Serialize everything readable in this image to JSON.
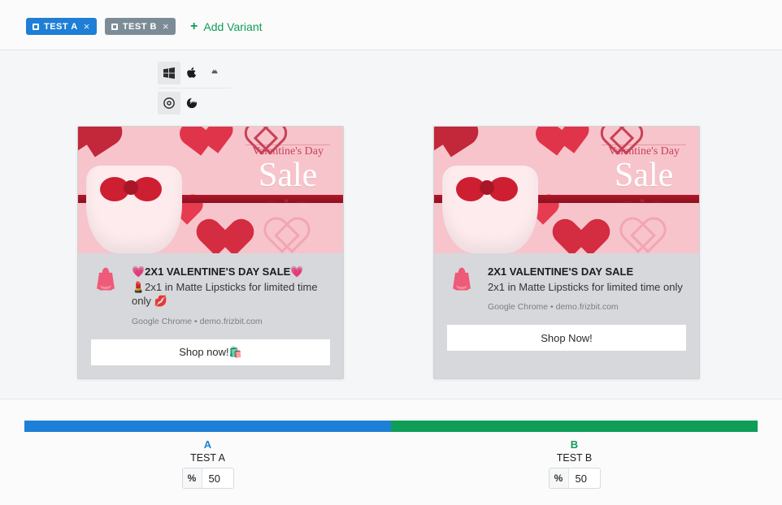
{
  "topbar": {
    "variants": [
      {
        "label": "TEST A",
        "active": true
      },
      {
        "label": "TEST B",
        "active": false
      }
    ],
    "add_variant_label": "Add Variant"
  },
  "toolbar": {
    "os_icons": [
      "windows",
      "apple",
      "android"
    ],
    "browser_icons": [
      "chrome",
      "firefox"
    ]
  },
  "hero": {
    "small_text": "Valentine's Day",
    "sale_text": "Sale"
  },
  "notif_a": {
    "title": "💗2X1 VALENTINE'S DAY SALE💗",
    "subtitle": "💄2x1 in Matte Lipsticks for limited time only 💋",
    "meta": "Google Chrome • demo.frizbit.com",
    "cta": "Shop now!🛍️"
  },
  "notif_b": {
    "title": "2X1 VALENTINE'S DAY SALE",
    "subtitle": "2x1 in Matte Lipsticks for limited time only",
    "meta": "Google Chrome • demo.frizbit.com",
    "cta": "Shop Now!"
  },
  "split": {
    "a": {
      "letter": "A",
      "name": "TEST A",
      "pct": "50"
    },
    "b": {
      "letter": "B",
      "name": "TEST B",
      "pct": "50"
    },
    "pct_symbol": "%"
  }
}
